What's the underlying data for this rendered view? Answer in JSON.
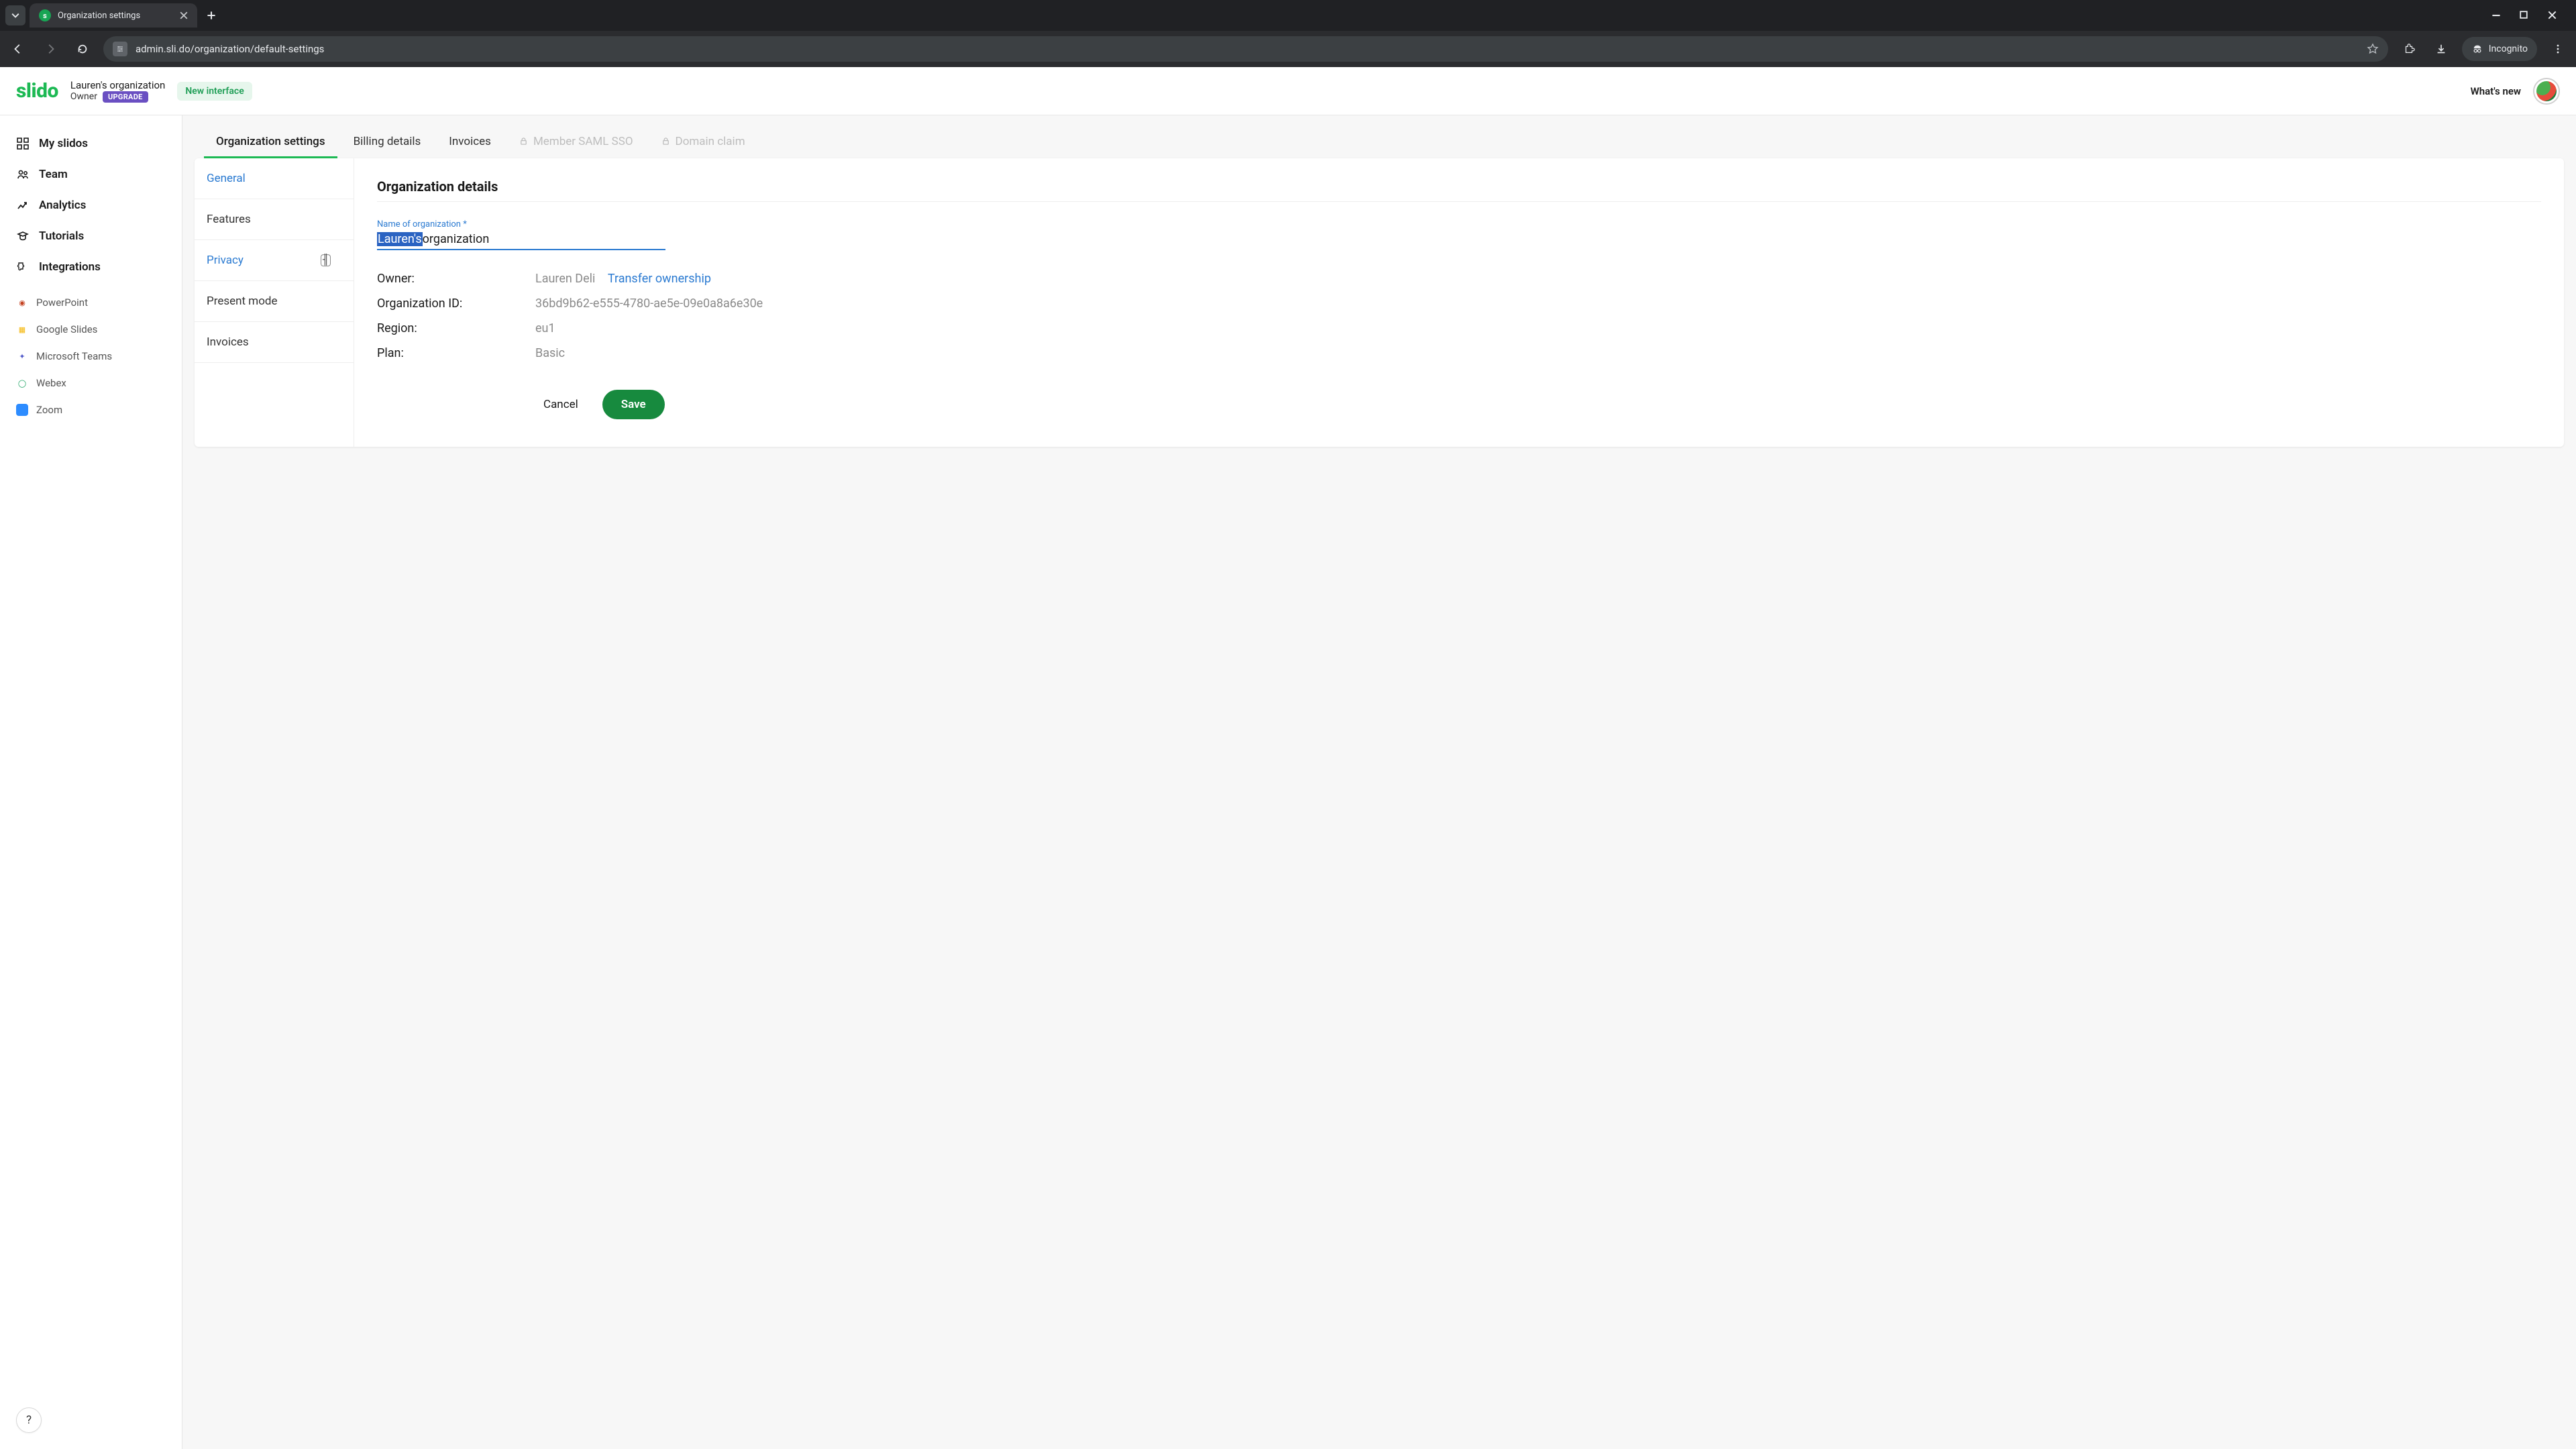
{
  "browser": {
    "tab_title": "Organization settings",
    "url": "admin.sli.do/organization/default-settings",
    "incognito_label": "Incognito"
  },
  "header": {
    "logo": "slido",
    "org_name": "Lauren's organization",
    "role": "Owner",
    "upgrade": "UPGRADE",
    "new_interface": "New interface",
    "whats_new": "What's new"
  },
  "sidebar": {
    "items": [
      {
        "label": "My slidos"
      },
      {
        "label": "Team"
      },
      {
        "label": "Analytics"
      },
      {
        "label": "Tutorials"
      },
      {
        "label": "Integrations"
      }
    ],
    "integrations": [
      {
        "label": "PowerPoint"
      },
      {
        "label": "Google Slides"
      },
      {
        "label": "Microsoft Teams"
      },
      {
        "label": "Webex"
      },
      {
        "label": "Zoom"
      }
    ],
    "help": "?"
  },
  "main_tabs": [
    {
      "label": "Organization settings",
      "active": true,
      "locked": false
    },
    {
      "label": "Billing details",
      "active": false,
      "locked": false
    },
    {
      "label": "Invoices",
      "active": false,
      "locked": false
    },
    {
      "label": "Member SAML SSO",
      "active": false,
      "locked": true
    },
    {
      "label": "Domain claim",
      "active": false,
      "locked": true
    }
  ],
  "sub_tabs": [
    {
      "label": "General",
      "active": true
    },
    {
      "label": "Features"
    },
    {
      "label": "Privacy",
      "hover": true
    },
    {
      "label": "Present mode"
    },
    {
      "label": "Invoices"
    }
  ],
  "panel": {
    "title": "Organization details",
    "field": {
      "label": "Name of organization",
      "required_mark": "*",
      "selected_text": "Lauren's",
      "rest_text": " organization"
    },
    "rows": {
      "owner_label": "Owner:",
      "owner_value": "Lauren Deli",
      "transfer_link": "Transfer ownership",
      "org_id_label": "Organization ID:",
      "org_id_value": "36bd9b62-e555-4780-ae5e-09e0a8a6e30e",
      "region_label": "Region:",
      "region_value": "eu1",
      "plan_label": "Plan:",
      "plan_value": "Basic"
    },
    "buttons": {
      "cancel": "Cancel",
      "save": "Save"
    }
  }
}
